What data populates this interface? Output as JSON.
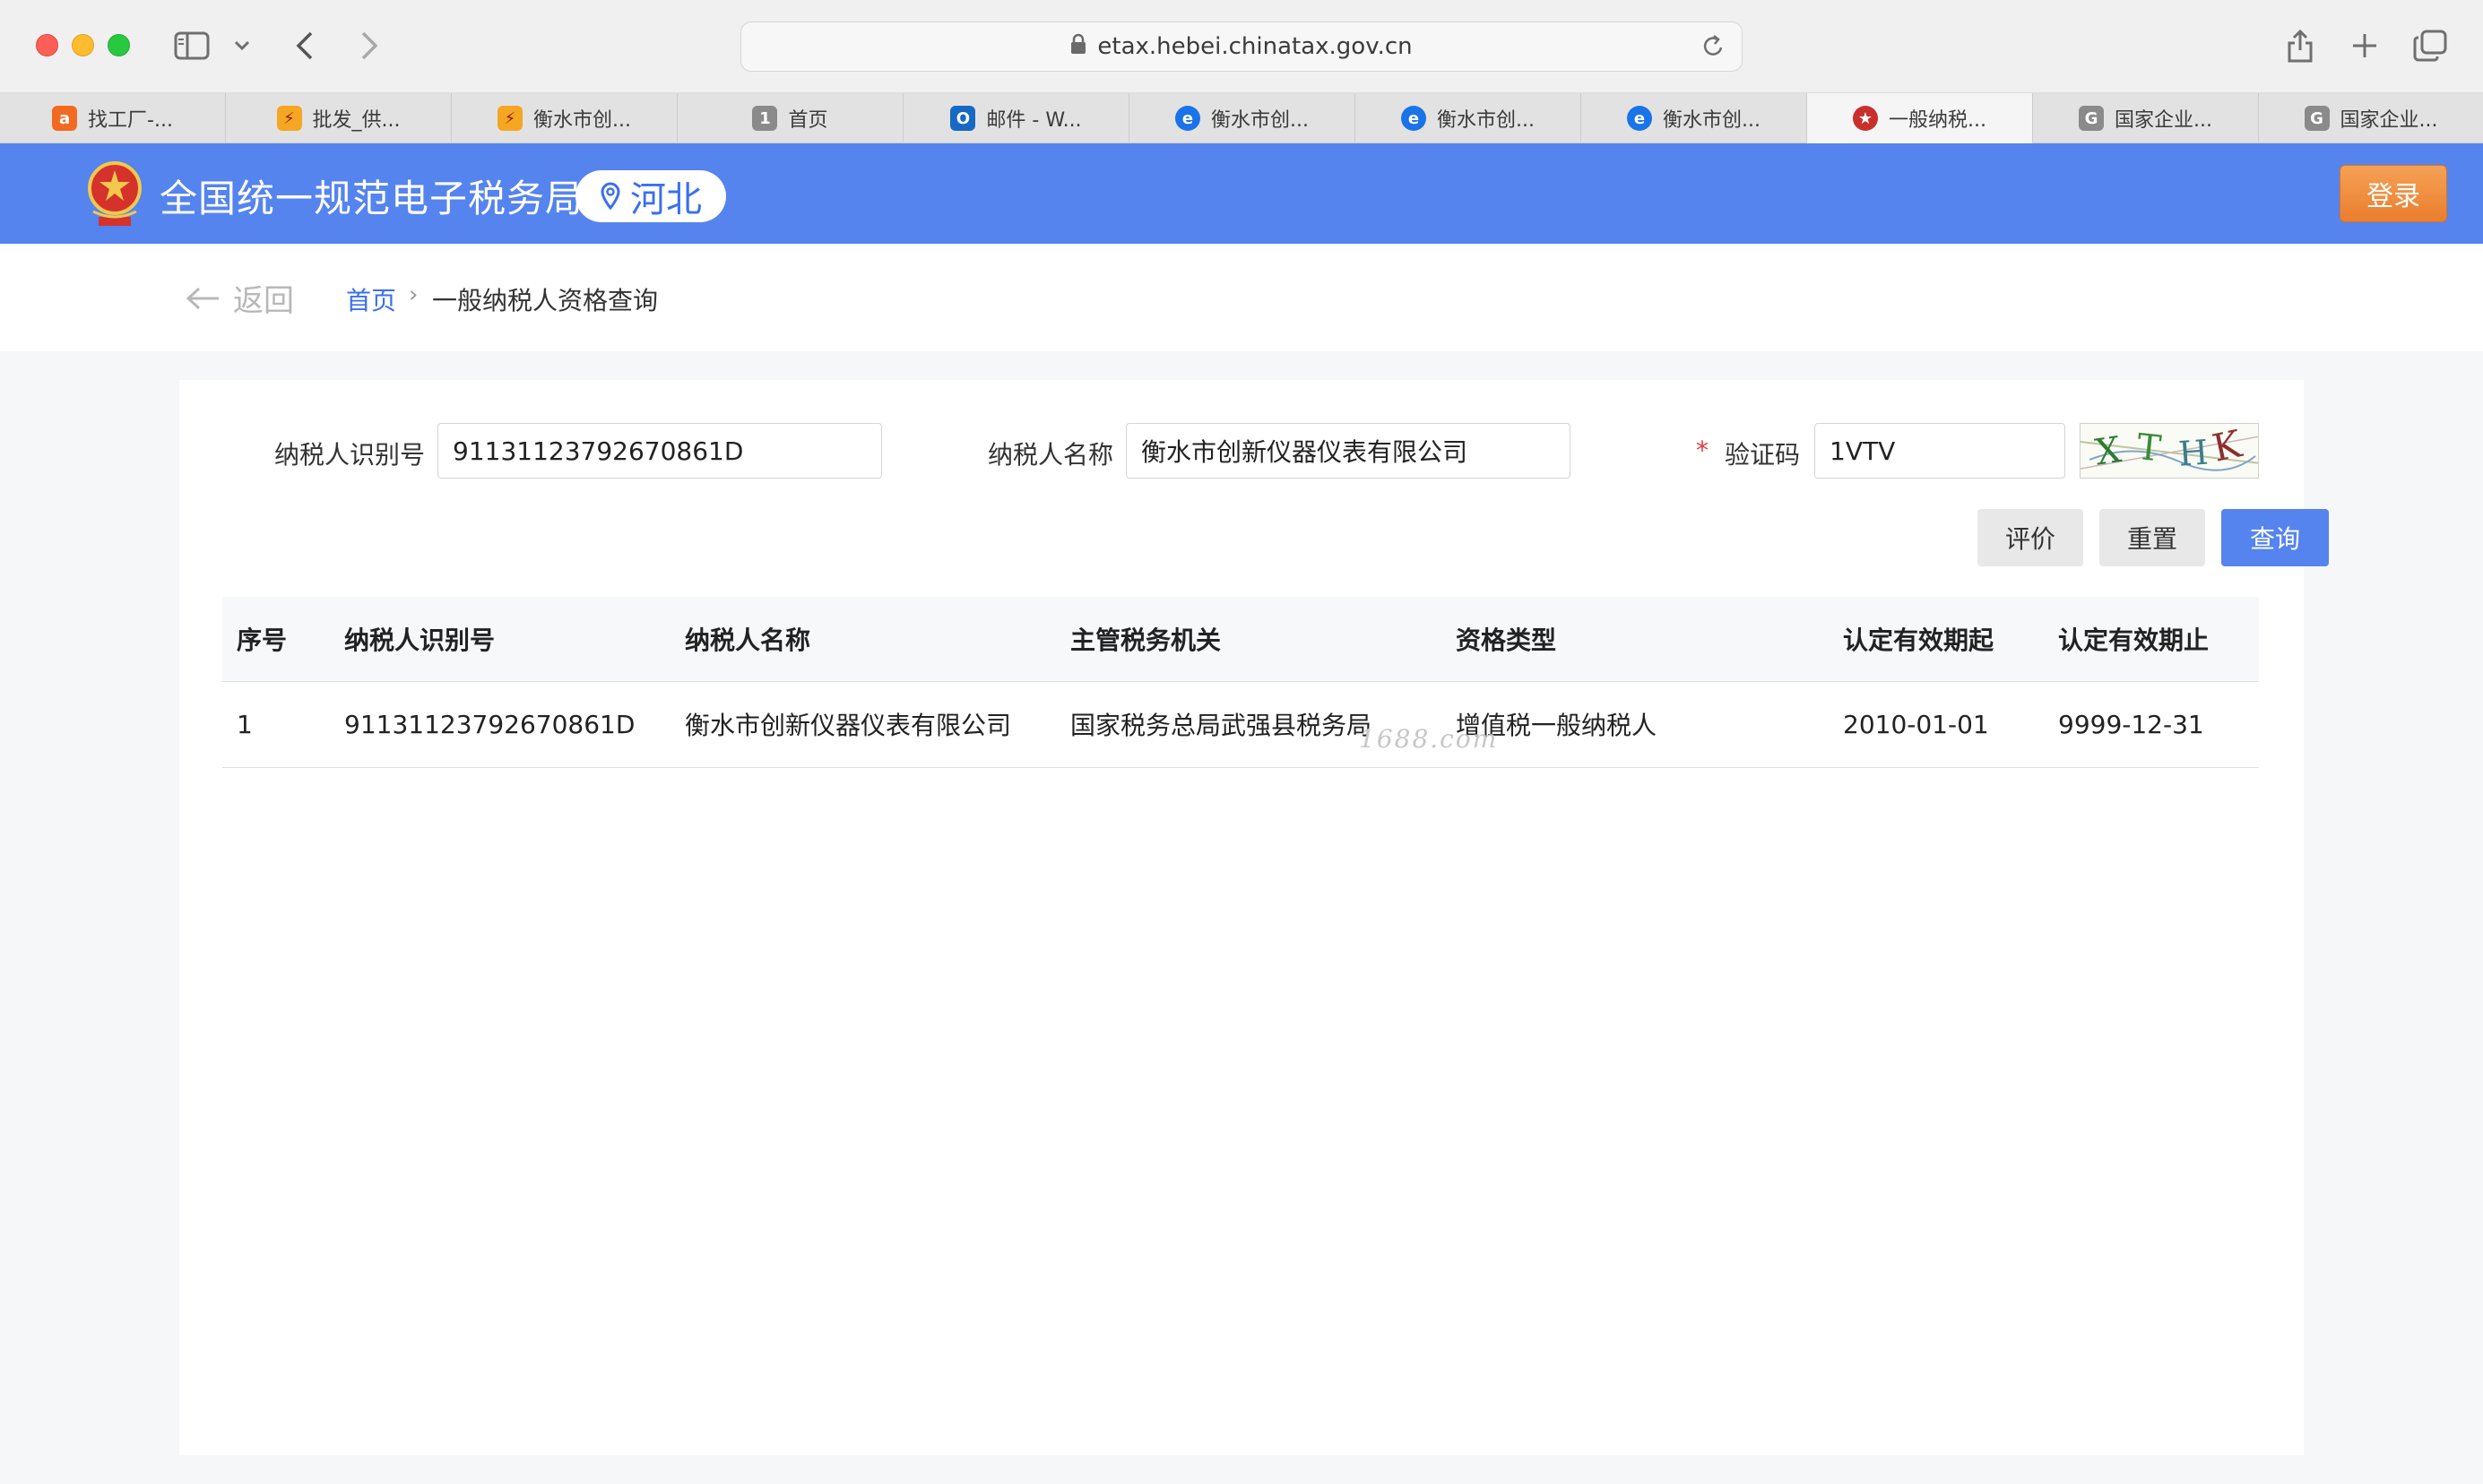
{
  "browser": {
    "url": "etax.hebei.chinatax.gov.cn",
    "tabs": [
      {
        "label": "找工厂-...",
        "icon": "alibaba-icon",
        "color": "#f26a21"
      },
      {
        "label": "批发_供...",
        "icon": "wholesale-icon",
        "color": "#f5a623"
      },
      {
        "label": "衡水市创...",
        "icon": "wholesale-icon",
        "color": "#f5a623"
      },
      {
        "label": "首页",
        "icon": "number-one-icon",
        "color": "#8a8a8a"
      },
      {
        "label": "邮件 - W...",
        "icon": "outlook-icon",
        "color": "#1769c4"
      },
      {
        "label": "衡水市创...",
        "icon": "edge-icon",
        "color": "#1a73e8"
      },
      {
        "label": "衡水市创...",
        "icon": "edge-icon",
        "color": "#1a73e8"
      },
      {
        "label": "衡水市创...",
        "icon": "edge-icon",
        "color": "#1a73e8"
      },
      {
        "label": "一般纳税...",
        "icon": "tax-emblem-icon",
        "color": "#c9302c"
      },
      {
        "label": "国家企业...",
        "icon": "g-icon",
        "color": "#8a8a8a"
      },
      {
        "label": "国家企业...",
        "icon": "g-icon",
        "color": "#8a8a8a"
      }
    ],
    "active_tab": 8
  },
  "header": {
    "site_title": "全国统一规范电子税务局",
    "region": "河北",
    "login_label": "登录",
    "brand_color": "#5584ee",
    "login_color": "#ea7e2e"
  },
  "breadcrumb": {
    "back_label": "返回",
    "home": "首页",
    "separator": "›",
    "current": "一般纳税人资格查询"
  },
  "form": {
    "taxpayer_id_label": "纳税人识别号",
    "taxpayer_id_value": "91131123792670861D",
    "taxpayer_name_label": "纳税人名称",
    "taxpayer_name_value": "衡水市创新仪器仪表有限公司",
    "captcha_label": "验证码",
    "captcha_required": "*",
    "captcha_value": "1VTV",
    "captcha_image_text": "XTHK",
    "buttons": {
      "evaluate": "评价",
      "reset": "重置",
      "query": "查询"
    }
  },
  "table": {
    "columns": [
      "序号",
      "纳税人识别号",
      "纳税人名称",
      "主管税务机关",
      "资格类型",
      "认定有效期起",
      "认定有效期止"
    ],
    "rows": [
      [
        "1",
        "91131123792670861D",
        "衡水市创新仪器仪表有限公司",
        "国家税务总局武强县税务局",
        "增值税一般纳税人",
        "2010-01-01",
        "9999-12-31"
      ]
    ]
  },
  "watermark": "1688.com"
}
